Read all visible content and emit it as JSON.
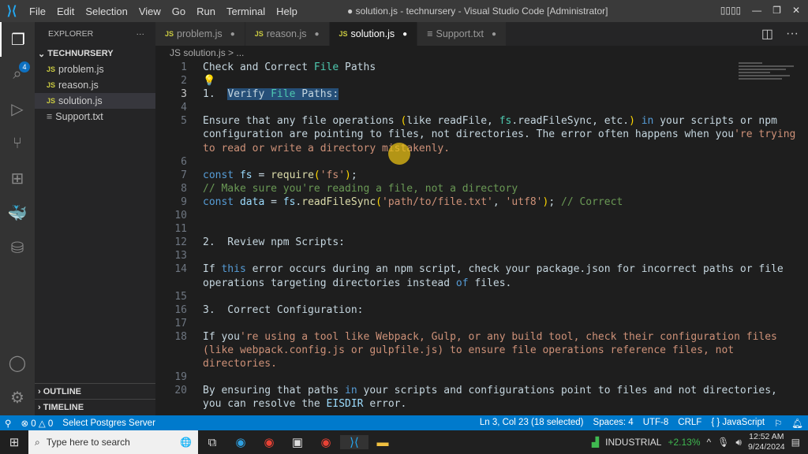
{
  "titlebar": {
    "menu": [
      "File",
      "Edit",
      "Selection",
      "View",
      "Go",
      "Run",
      "Terminal",
      "Help"
    ],
    "title": "● solution.js - technursery - Visual Studio Code [Administrator]"
  },
  "activity": {
    "badge": "4",
    "icons": [
      "files-icon",
      "search-icon",
      "run-debug-icon",
      "source-control-icon",
      "extensions-icon",
      "docker-icon",
      "database-icon"
    ]
  },
  "sidebar": {
    "header": "EXPLORER",
    "more": "···",
    "root": "TECHNURSERY",
    "files": [
      {
        "name": "problem.js",
        "type": "JS"
      },
      {
        "name": "reason.js",
        "type": "JS"
      },
      {
        "name": "solution.js",
        "type": "JS"
      },
      {
        "name": "Support.txt",
        "type": "≡"
      }
    ],
    "outline": "OUTLINE",
    "timeline": "TIMELINE"
  },
  "tabs": [
    {
      "label": "problem.js",
      "type": "JS",
      "dot": "●"
    },
    {
      "label": "reason.js",
      "type": "JS",
      "dot": "●"
    },
    {
      "label": "solution.js",
      "type": "JS",
      "dot": "●"
    },
    {
      "label": "Support.txt",
      "type": "≡",
      "dot": "●"
    }
  ],
  "breadcrumb": "JS solution.js > ...",
  "code": [
    {
      "n": "1",
      "t": [
        [
          "Check and Correct ",
          "d"
        ],
        [
          "File",
          "g"
        ],
        [
          " Paths",
          "d"
        ]
      ]
    },
    {
      "n": "2",
      "t": [
        [
          "💡",
          "bulb"
        ]
      ]
    },
    {
      "n": "3",
      "t": [
        [
          "1.  ",
          "d"
        ],
        [
          "Verify ",
          "d sel"
        ],
        [
          "File",
          "g sel"
        ],
        [
          " Paths:",
          "d sel"
        ]
      ],
      "cur": true
    },
    {
      "n": "4",
      "t": []
    },
    {
      "n": "5",
      "t": [
        [
          "Ensure that any file operations ",
          "d"
        ],
        [
          "(",
          "y"
        ],
        [
          "like readFile, ",
          "d"
        ],
        [
          "fs",
          "g"
        ],
        [
          ".readFileSync, etc.",
          "d"
        ],
        [
          ")",
          "y"
        ],
        [
          " ",
          "d"
        ],
        [
          "in",
          "b"
        ],
        [
          " your scripts or npm",
          "d"
        ]
      ]
    },
    {
      "n": "",
      "t": [
        [
          "configuration are pointing to files, not directories. The error often happens when you",
          "d"
        ],
        [
          "'re trying",
          "o"
        ]
      ]
    },
    {
      "n": "",
      "t": [
        [
          "to read or write a directory mistakenly.",
          "o"
        ]
      ]
    },
    {
      "n": "6",
      "t": []
    },
    {
      "n": "7",
      "t": [
        [
          "const",
          "b"
        ],
        [
          " fs ",
          "v"
        ],
        [
          "= ",
          "d"
        ],
        [
          "require",
          "f"
        ],
        [
          "(",
          "y"
        ],
        [
          "'fs'",
          "o"
        ],
        [
          ")",
          "y"
        ],
        [
          ";",
          "d"
        ]
      ]
    },
    {
      "n": "8",
      "t": [
        [
          "// Make sure you're reading a file, not a directory",
          "c"
        ]
      ]
    },
    {
      "n": "9",
      "t": [
        [
          "const",
          "b"
        ],
        [
          " data ",
          "v"
        ],
        [
          "= ",
          "d"
        ],
        [
          "fs",
          "v"
        ],
        [
          ".",
          "d"
        ],
        [
          "readFileSync",
          "f"
        ],
        [
          "(",
          "y"
        ],
        [
          "'path/to/file.txt'",
          "o"
        ],
        [
          ", ",
          "d"
        ],
        [
          "'utf8'",
          "o"
        ],
        [
          ")",
          "y"
        ],
        [
          "; ",
          "d"
        ],
        [
          "// Correct",
          "c"
        ]
      ]
    },
    {
      "n": "10",
      "t": []
    },
    {
      "n": "11",
      "t": []
    },
    {
      "n": "12",
      "t": [
        [
          "2.  Review npm Scripts:",
          "d"
        ]
      ]
    },
    {
      "n": "13",
      "t": []
    },
    {
      "n": "14",
      "t": [
        [
          "If ",
          "d"
        ],
        [
          "this",
          "b"
        ],
        [
          " error occurs during an npm script, check your package.json for incorrect paths or file",
          "d"
        ]
      ]
    },
    {
      "n": "",
      "t": [
        [
          "operations targeting directories instead ",
          "d"
        ],
        [
          "of",
          "b"
        ],
        [
          " files.",
          "d"
        ]
      ]
    },
    {
      "n": "15",
      "t": []
    },
    {
      "n": "16",
      "t": [
        [
          "3.  Correct Configuration:",
          "d"
        ]
      ]
    },
    {
      "n": "17",
      "t": []
    },
    {
      "n": "18",
      "t": [
        [
          "If you",
          "d"
        ],
        [
          "'re using a tool like Webpack, Gulp, or any build tool, check their configuration files",
          "o"
        ]
      ]
    },
    {
      "n": "",
      "t": [
        [
          "(like webpack.config.js or gulpfile.js) to ensure file operations reference files, not",
          "o"
        ]
      ]
    },
    {
      "n": "",
      "t": [
        [
          "directories.",
          "o"
        ]
      ]
    },
    {
      "n": "19",
      "t": []
    },
    {
      "n": "20",
      "t": [
        [
          "By ensuring that paths ",
          "d"
        ],
        [
          "in",
          "b"
        ],
        [
          " your scripts and configurations point to files and not directories,",
          "d"
        ]
      ]
    },
    {
      "n": "",
      "t": [
        [
          "you can resolve the ",
          "d"
        ],
        [
          "EISDIR",
          "v"
        ],
        [
          " error.",
          "d"
        ]
      ]
    }
  ],
  "status": {
    "problems": "⊗ 0 △ 0",
    "postgres": "Select Postgres Server",
    "position": "Ln 3, Col 23 (18 selected)",
    "spaces": "Spaces: 4",
    "encoding": "UTF-8",
    "eol": "CRLF",
    "language": "{ } JavaScript"
  },
  "taskbar": {
    "search_placeholder": "Type here to search",
    "stock": "INDUSTRIAL",
    "stock_change": "+2.13%",
    "time": "12:52 AM",
    "date": "9/24/2024"
  }
}
